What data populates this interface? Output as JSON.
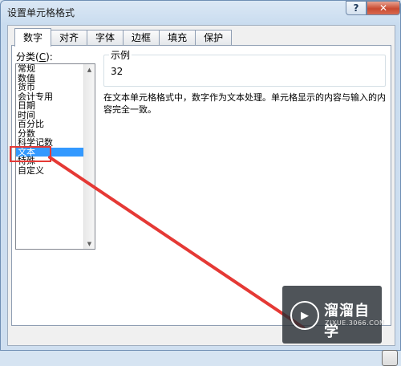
{
  "window": {
    "title": "设置单元格格式",
    "help_label": "?",
    "close_label": "✕"
  },
  "tabs": [
    {
      "label": "数字",
      "active": true
    },
    {
      "label": "对齐"
    },
    {
      "label": "字体"
    },
    {
      "label": "边框"
    },
    {
      "label": "填充"
    },
    {
      "label": "保护"
    }
  ],
  "category": {
    "label_prefix": "分类(",
    "label_key": "C",
    "label_suffix": "):",
    "items": [
      "常规",
      "数值",
      "货币",
      "会计专用",
      "日期",
      "时间",
      "百分比",
      "分数",
      "科学记数",
      "文本",
      "特殊",
      "自定义"
    ],
    "selected": "文本"
  },
  "sample": {
    "title": "示例",
    "value": "32"
  },
  "description": "在文本单元格格式中，数字作为文本处理。单元格显示的内容与输入的内容完全一致。",
  "annotation": {
    "color": "#e53935"
  },
  "watermark": {
    "name": "溜溜自学",
    "url": "ZIXUE.3066.COM",
    "logo": "play-icon"
  }
}
